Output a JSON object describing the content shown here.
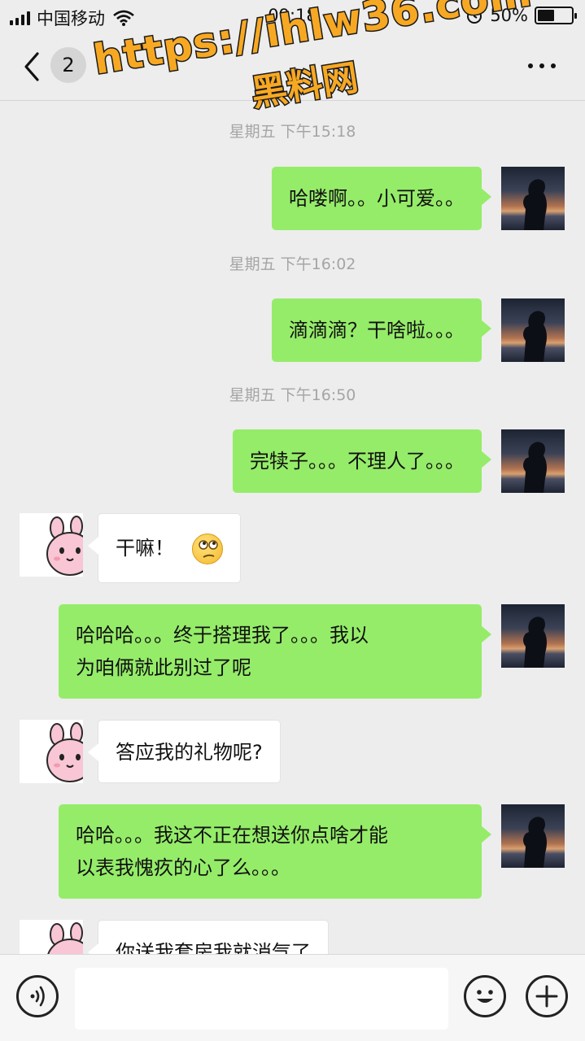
{
  "status_bar": {
    "carrier": "中国移动",
    "time": "09:18",
    "battery": "50%",
    "battery_level": 0.5,
    "icons": [
      "signal-icon",
      "wifi-icon",
      "alarm-icon",
      "battery-icon"
    ]
  },
  "nav": {
    "back_icon": "chevron-left-icon",
    "unread_count": "2",
    "title": "",
    "more_icon": "more-dots-icon"
  },
  "watermark": {
    "url": "https://ihlw36.com",
    "name": "黑料网",
    "color": "#f7a823"
  },
  "messages": [
    {
      "type": "time",
      "text": "星期五 下午15:18"
    },
    {
      "type": "msg",
      "side": "me",
      "text": "哈喽啊。。小可爱。。"
    },
    {
      "type": "time",
      "text": "星期五 下午16:02"
    },
    {
      "type": "msg",
      "side": "me",
      "text": "滴滴滴？干啥啦。。。"
    },
    {
      "type": "time",
      "text": "星期五 下午16:50"
    },
    {
      "type": "msg",
      "side": "me",
      "text": "完犊子。。。不理人了。。。"
    },
    {
      "type": "msg",
      "side": "friend",
      "text": "干嘛！",
      "emoji": "thinking-face-icon"
    },
    {
      "type": "msg",
      "side": "me",
      "lines": [
        "哈哈哈。。。终于搭理我了。。。我以",
        "为咱俩就此别过了呢"
      ]
    },
    {
      "type": "msg",
      "side": "friend",
      "text": "答应我的礼物呢?"
    },
    {
      "type": "msg",
      "side": "me",
      "lines": [
        "哈哈。。。我这不正在想送你点啥才能",
        "以表我愧疚的心了么。。。"
      ]
    },
    {
      "type": "msg",
      "side": "friend",
      "text": "你送我套房我就消气了"
    }
  ],
  "colors": {
    "background": "#ededed",
    "my_bubble": "#95ec69",
    "friend_bubble": "#ffffff",
    "timestamp": "#a5a5a5"
  },
  "input_bar": {
    "voice_icon": "voice-icon",
    "input_value": "",
    "emoji_icon": "emoji-icon",
    "add_icon": "plus-icon"
  }
}
